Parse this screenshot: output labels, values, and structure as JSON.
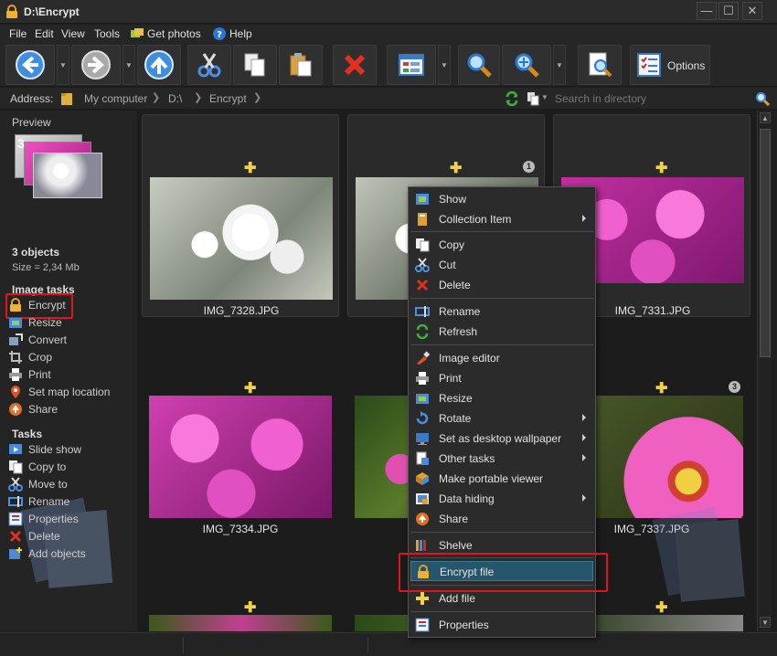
{
  "window": {
    "title": "D:\\Encrypt",
    "buttons": {
      "minimize": "—",
      "maximize": "☐",
      "close": "✕"
    }
  },
  "menu": {
    "file": "File",
    "edit": "Edit",
    "view": "View",
    "tools": "Tools",
    "get_photos": "Get photos",
    "help": "Help"
  },
  "toolbar": {
    "options_label": "Options",
    "icons": [
      "back-icon",
      "forward-icon",
      "up-icon",
      "cut-icon",
      "copy-icon",
      "paste-icon",
      "delete-icon",
      "view-mode-icon",
      "search-icon",
      "zoom-icon",
      "preview-icon",
      "options-icon"
    ]
  },
  "address": {
    "label": "Address:",
    "crumbs": [
      "My computer",
      "D:\\",
      "Encrypt"
    ],
    "search_placeholder": "Search in directory"
  },
  "sidebar": {
    "preview_heading": "Preview",
    "preview_count": "3",
    "objects": "3 objects",
    "size": "Size = 2,34 Mb",
    "image_tasks_heading": "Image tasks",
    "image_tasks": [
      {
        "label": "Encrypt",
        "icon": "lock-icon"
      },
      {
        "label": "Resize",
        "icon": "resize-icon"
      },
      {
        "label": "Convert",
        "icon": "convert-icon"
      },
      {
        "label": "Crop",
        "icon": "crop-icon"
      },
      {
        "label": "Print",
        "icon": "print-icon"
      },
      {
        "label": "Set map location",
        "icon": "map-pin-icon"
      },
      {
        "label": "Share",
        "icon": "share-icon"
      }
    ],
    "tasks_heading": "Tasks",
    "tasks": [
      {
        "label": "Slide show",
        "icon": "slideshow-icon"
      },
      {
        "label": "Copy to",
        "icon": "copy-to-icon"
      },
      {
        "label": "Move to",
        "icon": "move-to-icon"
      },
      {
        "label": "Rename",
        "icon": "rename-icon"
      },
      {
        "label": "Properties",
        "icon": "properties-icon"
      },
      {
        "label": "Delete",
        "icon": "delete-icon"
      },
      {
        "label": "Add objects",
        "icon": "add-objects-icon"
      }
    ]
  },
  "tiles": [
    {
      "name": "IMG_7328.JPG",
      "kind": "white"
    },
    {
      "name": "",
      "kind": "white",
      "badge": "1"
    },
    {
      "name": "IMG_7331.JPG",
      "kind": "pink"
    },
    {
      "name": "IMG_7334.JPG",
      "kind": "pink"
    },
    {
      "name": "",
      "kind": "green"
    },
    {
      "name": "IMG_7337.JPG",
      "kind": "daisy",
      "badge": "3"
    }
  ],
  "context_menu": {
    "items": [
      {
        "label": "Show",
        "icon": "show-icon"
      },
      {
        "label": "Collection Item",
        "icon": "collection-icon",
        "submenu": true
      },
      {
        "label": "Copy",
        "icon": "copy-icon"
      },
      {
        "label": "Cut",
        "icon": "cut-icon"
      },
      {
        "label": "Delete",
        "icon": "delete-icon"
      },
      {
        "label": "Rename",
        "icon": "rename-icon"
      },
      {
        "label": "Refresh",
        "icon": "refresh-icon"
      },
      {
        "label": "Image editor",
        "icon": "image-editor-icon"
      },
      {
        "label": "Print",
        "icon": "print-icon"
      },
      {
        "label": "Resize",
        "icon": "resize-icon"
      },
      {
        "label": "Rotate",
        "icon": "rotate-icon",
        "submenu": true
      },
      {
        "label": "Set as desktop wallpaper",
        "icon": "wallpaper-icon",
        "submenu": true
      },
      {
        "label": "Other tasks",
        "icon": "other-tasks-icon",
        "submenu": true
      },
      {
        "label": "Make portable viewer",
        "icon": "portable-viewer-icon"
      },
      {
        "label": "Data hiding",
        "icon": "data-hiding-icon",
        "submenu": true
      },
      {
        "label": "Share",
        "icon": "share-icon"
      },
      {
        "label": "Shelve",
        "icon": "shelve-icon"
      },
      {
        "label": "Encrypt file",
        "icon": "lock-icon",
        "highlighted": true
      },
      {
        "label": "Add file",
        "icon": "add-file-icon"
      },
      {
        "label": "Properties",
        "icon": "properties-icon"
      }
    ]
  },
  "colors": {
    "highlight_red": "#e0141c",
    "menu_highlight": "#26566b"
  }
}
